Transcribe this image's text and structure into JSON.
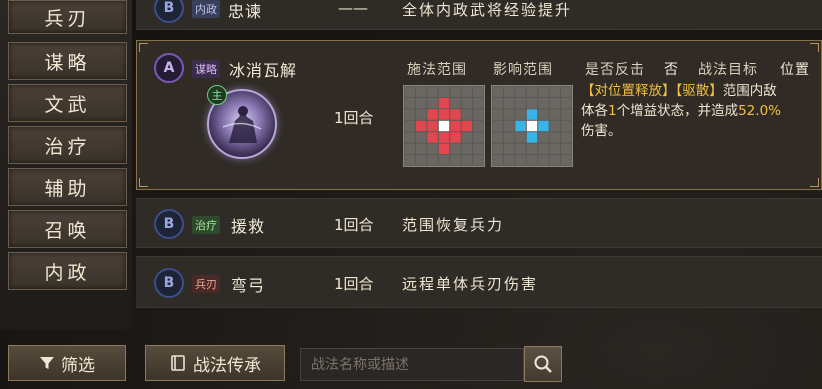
{
  "sidebar": {
    "items": [
      {
        "label": "兵刃"
      },
      {
        "label": "谋略"
      },
      {
        "label": "文武"
      },
      {
        "label": "治疗"
      },
      {
        "label": "辅助"
      },
      {
        "label": "召唤"
      },
      {
        "label": "内政"
      }
    ]
  },
  "tactics": [
    {
      "grade": "B",
      "type": "内政",
      "name": "忠谏",
      "turns": "——",
      "desc": "全体内政武将经验提升"
    },
    {
      "grade": "A",
      "type": "谋略",
      "name": "冰消瓦解",
      "turns": "1回合",
      "desc": ""
    },
    {
      "grade": "B",
      "type": "治疗",
      "name": "援救",
      "turns": "1回合",
      "desc": "范围恢复兵力"
    },
    {
      "grade": "B",
      "type": "兵刃",
      "name": "弯弓",
      "turns": "1回合",
      "desc": "远程单体兵刃伤害"
    }
  ],
  "detail": {
    "main_badge": "主",
    "cast_range_label": "施法范围",
    "effect_range_label": "影响范围",
    "counter_label": "是否反击",
    "counter_value": "否",
    "target_label": "战法目标",
    "target_value": "位置",
    "effect_tag1": "【对位置释放】",
    "effect_tag2": "【驱散】",
    "effect_text1": "范围内敌",
    "effect_text2": "体各",
    "effect_num": "1",
    "effect_text3": "个增益状态，并造成",
    "effect_pct": "52.0%",
    "effect_text4": "伤害。"
  },
  "toolbar": {
    "filter_label": "筛选",
    "inherit_label": "战法传承",
    "search_placeholder": "战法名称或描述"
  },
  "colors": {
    "gold": "#f2c040",
    "frame": "#8a7248",
    "red_cell": "#e2474f",
    "blue_cell": "#39b4e8"
  }
}
